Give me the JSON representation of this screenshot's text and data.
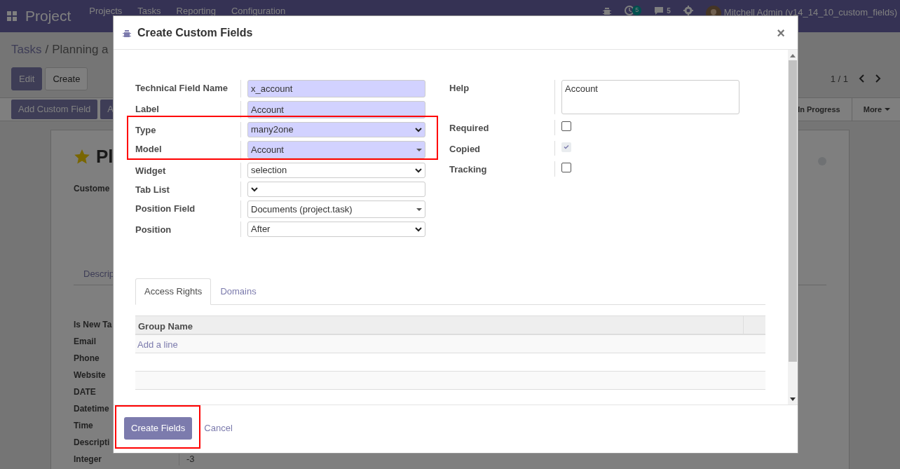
{
  "navbar": {
    "brand": "Project",
    "menu": [
      "Projects",
      "Tasks",
      "Reporting",
      "Configuration"
    ],
    "activity_count": "5",
    "message_count": "5",
    "user": "Mitchell Admin (v14_14_10_custom_fields)"
  },
  "breadcrumb": {
    "items": [
      "Tasks",
      "Planning a"
    ],
    "separator": "/"
  },
  "control_panel": {
    "buttons": [
      {
        "label": "Edit",
        "kind": "primary"
      },
      {
        "label": "Create",
        "kind": "secondary"
      }
    ],
    "pager": "1 / 1"
  },
  "action_bar": {
    "buttons": [
      "Add Custom Field",
      "A"
    ],
    "stage": "In Progress",
    "more": "More"
  },
  "sheet": {
    "title": "Pl",
    "starred": true,
    "customer_label": "Custome",
    "tab": "Descrip",
    "fields": [
      {
        "label": "Is New Ta"
      },
      {
        "label": "Email"
      },
      {
        "label": "Phone"
      },
      {
        "label": "Website"
      },
      {
        "label": "DATE"
      },
      {
        "label": "Datetime"
      },
      {
        "label": "Time"
      },
      {
        "label": "Descripti"
      },
      {
        "label": "Integer",
        "value": "-3"
      }
    ]
  },
  "dialog": {
    "title": "Create Custom Fields",
    "close": "×",
    "left_fields": [
      {
        "label": "Technical Field Name",
        "kind": "text",
        "value": "x_account",
        "required": true,
        "highlighted": false
      },
      {
        "label": "Label",
        "kind": "text",
        "value": "Account",
        "required": true,
        "highlighted": false
      },
      {
        "label": "Type",
        "kind": "select",
        "value": "many2one",
        "required": true,
        "highlighted": true
      },
      {
        "label": "Model",
        "kind": "many2one",
        "value": "Account",
        "required": true,
        "highlighted": true
      },
      {
        "label": "Widget",
        "kind": "select",
        "value": "selection",
        "required": false,
        "highlighted": false
      },
      {
        "label": "Tab List",
        "kind": "select",
        "required": false,
        "highlighted": false
      },
      {
        "label": "Position Field",
        "kind": "many2one",
        "value": "Documents (project.task)",
        "required": false,
        "highlighted": false
      },
      {
        "label": "Position",
        "kind": "select",
        "value": "After",
        "required": false,
        "highlighted": false
      }
    ],
    "right_fields": [
      {
        "label": "Help",
        "kind": "textarea",
        "value": "Account"
      },
      {
        "label": "Required",
        "kind": "checkbox",
        "checked": false,
        "disabled": false
      },
      {
        "label": "Copied",
        "kind": "checkbox",
        "checked": true,
        "disabled": true
      },
      {
        "label": "Tracking",
        "kind": "checkbox",
        "checked": false,
        "disabled": false
      }
    ],
    "tabs": [
      {
        "label": "Access Rights",
        "selected": true
      },
      {
        "label": "Domains",
        "selected": false
      }
    ],
    "table": {
      "columns": [
        "Group Name"
      ],
      "add_line": "Add a line"
    },
    "footer": [
      {
        "label": "Create Fields",
        "kind": "primary",
        "highlighted": true
      },
      {
        "label": "Cancel",
        "kind": "link",
        "highlighted": false
      }
    ]
  }
}
